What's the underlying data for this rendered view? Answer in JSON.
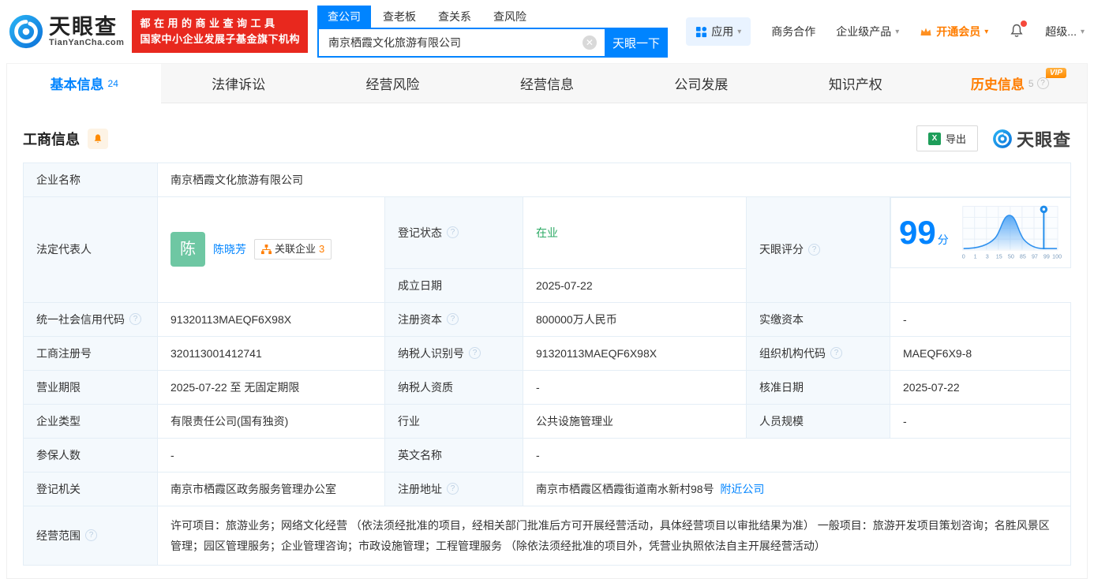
{
  "header": {
    "logo": {
      "title": "天眼查",
      "domain": "TianYanCha.com"
    },
    "slogan": {
      "line1": "都在用的商业查询工具",
      "line2": "国家中小企业发展子基金旗下机构"
    },
    "search": {
      "tabs": [
        {
          "label": "查公司"
        },
        {
          "label": "查老板"
        },
        {
          "label": "查关系"
        },
        {
          "label": "查风险"
        }
      ],
      "value": "南京栖霞文化旅游有限公司",
      "button": "天眼一下"
    },
    "nav": {
      "apps": "应用",
      "cooperation": "商务合作",
      "enterprise": "企业级产品",
      "vip": "开通会员",
      "super": "超级..."
    }
  },
  "tabs": [
    {
      "label": "基本信息",
      "count": "24"
    },
    {
      "label": "法律诉讼"
    },
    {
      "label": "经营风险"
    },
    {
      "label": "经营信息"
    },
    {
      "label": "公司发展"
    },
    {
      "label": "知识产权"
    },
    {
      "label": "历史信息",
      "count": "5",
      "vip": "VIP"
    }
  ],
  "toolbar": {
    "section_title": "工商信息",
    "export_label": "导出",
    "brand": "天眼查"
  },
  "info": {
    "name_label": "企业名称",
    "name": "南京栖霞文化旅游有限公司",
    "legal_label": "法定代表人",
    "legal_avatar": "陈",
    "legal_name": "陈晓芳",
    "related_label": "关联企业",
    "related_count": "3",
    "status_label": "登记状态",
    "status_value": "在业",
    "established_label": "成立日期",
    "established_value": "2025-07-22",
    "score_label": "天眼评分",
    "credit_code_label": "统一社会信用代码",
    "credit_code": "91320113MAEQF6X98X",
    "reg_capital_label": "注册资本",
    "reg_capital": "800000万人民币",
    "paid_capital_label": "实缴资本",
    "paid_capital": "-",
    "reg_number_label": "工商注册号",
    "reg_number": "320113001412741",
    "taxpayer_id_label": "纳税人识别号",
    "taxpayer_id": "91320113MAEQF6X98X",
    "org_code_label": "组织机构代码",
    "org_code": "MAEQF6X9-8",
    "term_label": "营业期限",
    "term_value": "2025-07-22 至 无固定期限",
    "taxpayer_quality_label": "纳税人资质",
    "taxpayer_quality": "-",
    "approval_label": "核准日期",
    "approval_value": "2025-07-22",
    "type_label": "企业类型",
    "type_value": "有限责任公司(国有独资)",
    "industry_label": "行业",
    "industry_value": "公共设施管理业",
    "staff_label": "人员规模",
    "staff_value": "-",
    "insured_label": "参保人数",
    "insured_value": "-",
    "english_label": "英文名称",
    "english_value": "-",
    "authority_label": "登记机关",
    "authority_value": "南京市栖霞区政务服务管理办公室",
    "address_label": "注册地址",
    "address_value": "南京市栖霞区栖霞街道南水新村98号",
    "nearby_link": "附近公司",
    "scope_label": "经营范围",
    "scope_value": "许可项目：旅游业务；网络文化经营 （依法须经批准的项目，经相关部门批准后方可开展经营活动，具体经营项目以审批结果为准） 一般项目：旅游开发项目策划咨询；名胜风景区管理；园区管理服务；企业管理咨询；市政设施管理；工程管理服务 （除依法须经批准的项目外，凭营业执照依法自主开展经营活动）"
  },
  "score_chart": {
    "type": "area",
    "score": "99",
    "unit": "分",
    "axis_labels": [
      "0",
      "1",
      "3",
      "15",
      "50",
      "85",
      "97",
      "99",
      "100"
    ],
    "marker_value": "99"
  },
  "colors": {
    "accent_blue": "#0084ff",
    "vip_orange": "#ff7d00",
    "status_green": "#2baa64",
    "banner_red": "#e8281e",
    "label_bg": "#f4f9fd",
    "table_border": "#e4eef6"
  }
}
